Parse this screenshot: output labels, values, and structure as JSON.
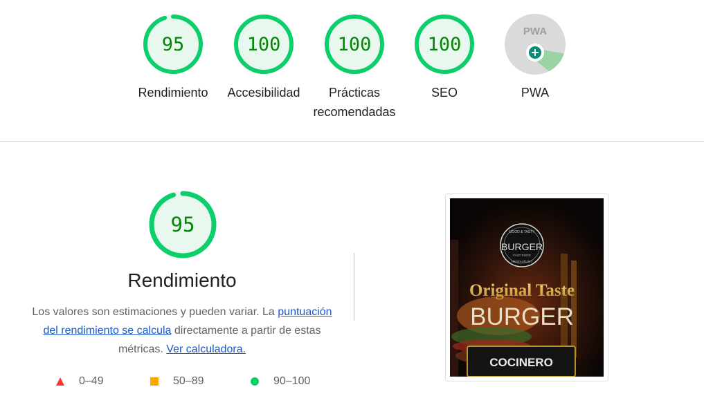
{
  "colors": {
    "pass": "#0cce6b",
    "pass_fill": "#e8f8ef",
    "pass_text": "#008800",
    "average": "#ffa400",
    "fail": "#ff3333",
    "link": "#1a57c9"
  },
  "top_scores": [
    {
      "score": "95",
      "value": 95,
      "label": "Rendimiento"
    },
    {
      "score": "100",
      "value": 100,
      "label": "Accesibilidad"
    },
    {
      "score": "100",
      "value": 100,
      "label": "Prácticas recomendadas"
    },
    {
      "score": "100",
      "value": 100,
      "label": "SEO"
    }
  ],
  "pwa": {
    "label": "PWA",
    "badge_text": "PWA",
    "icon": "plus-circle-icon"
  },
  "main": {
    "score": "95",
    "value": 95,
    "title": "Rendimiento",
    "desc_1": "Los valores son estimaciones y pueden variar. La ",
    "desc_link_1": "puntuación del rendimiento se calcula",
    "desc_2": " directamente a partir de estas métricas. ",
    "desc_link_2": "Ver calculadora."
  },
  "legend": [
    {
      "range": "0–49",
      "shape": "triangle"
    },
    {
      "range": "50–89",
      "shape": "square"
    },
    {
      "range": "90–100",
      "shape": "circle"
    }
  ],
  "screenshot": {
    "logo_top": "GOOD & TASTY",
    "logo_main": "BURGER",
    "logo_sub": "FAST FOOD",
    "logo_bottom": "RESTAURANT",
    "headline": "Original Taste",
    "subheadline": "BURGER",
    "button": "COCINERO"
  }
}
